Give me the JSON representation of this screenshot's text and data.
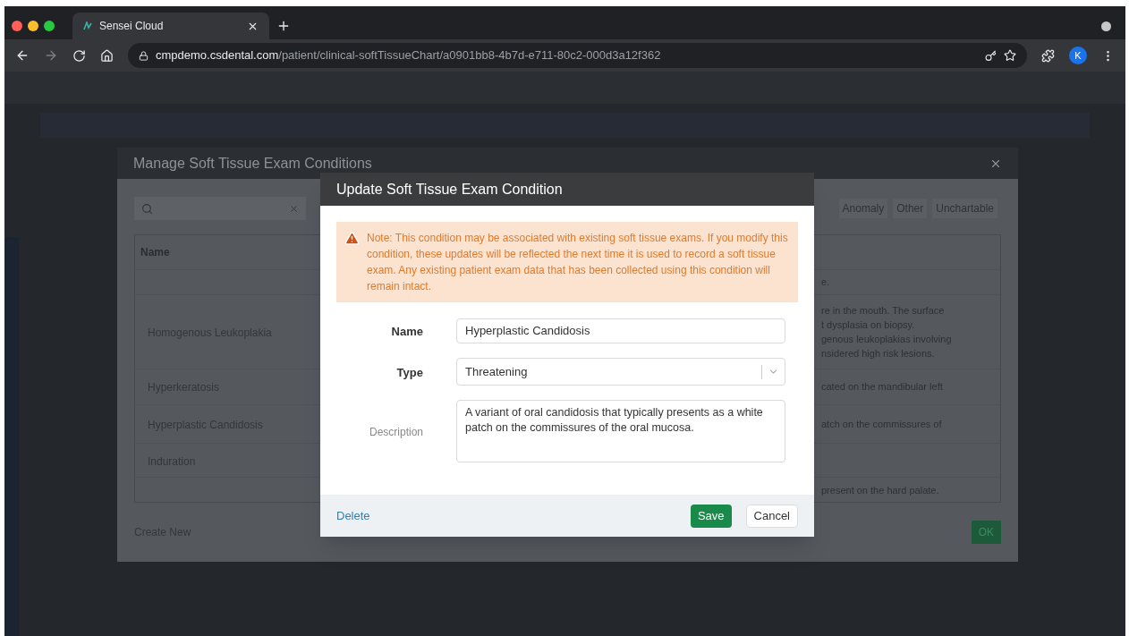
{
  "browser": {
    "tab_title": "Sensei Cloud",
    "url_host": "cmpdemo.csdental.com",
    "url_path": "/patient/clinical-softTissueChart/a0901bb8-4b7d-e711-80c2-000d3a12f362",
    "avatar_letter": "K"
  },
  "background_dialog": {
    "title": "Manage Soft Tissue Exam Conditions",
    "filters": [
      "Anomaly",
      "Other",
      "Unchartable"
    ],
    "columns": [
      "Name"
    ],
    "rows": [
      {
        "name": "",
        "description": "e."
      },
      {
        "name": "Homogenous Leukoplakia",
        "description": "re in the mouth. The surface\nt dysplasia on biopsy.\ngenous leukoplakias involving\nnsidered high risk lesions."
      },
      {
        "name": "Hyperkeratosis",
        "description": "cated on the mandibular left"
      },
      {
        "name": "Hyperplastic Candidosis",
        "description": "atch on the commissures of"
      },
      {
        "name": "Induration",
        "description": ""
      },
      {
        "name": "",
        "description": "present on the hard palate."
      }
    ],
    "create_link": "Create New",
    "ok_button": "OK"
  },
  "dialog": {
    "title": "Update Soft Tissue Exam Condition",
    "warning": "Note: This condition may be associated with existing soft tissue exams. If you modify this condition, these updates will be reflected the next time it is used to record a soft tissue exam. Any existing patient exam data that has been collected using this condition will remain intact.",
    "fields": [
      {
        "kind": "text",
        "label": "Name",
        "value": "Hyperplastic Candidosis"
      },
      {
        "kind": "select",
        "label": "Type",
        "value": "Threatening"
      },
      {
        "kind": "textarea",
        "label": "Description",
        "value": "A variant of oral candidosis that typically presents as a white patch on the commissures of the oral mucosa."
      }
    ],
    "delete_link": "Delete",
    "save_button": "Save",
    "cancel_button": "Cancel"
  }
}
